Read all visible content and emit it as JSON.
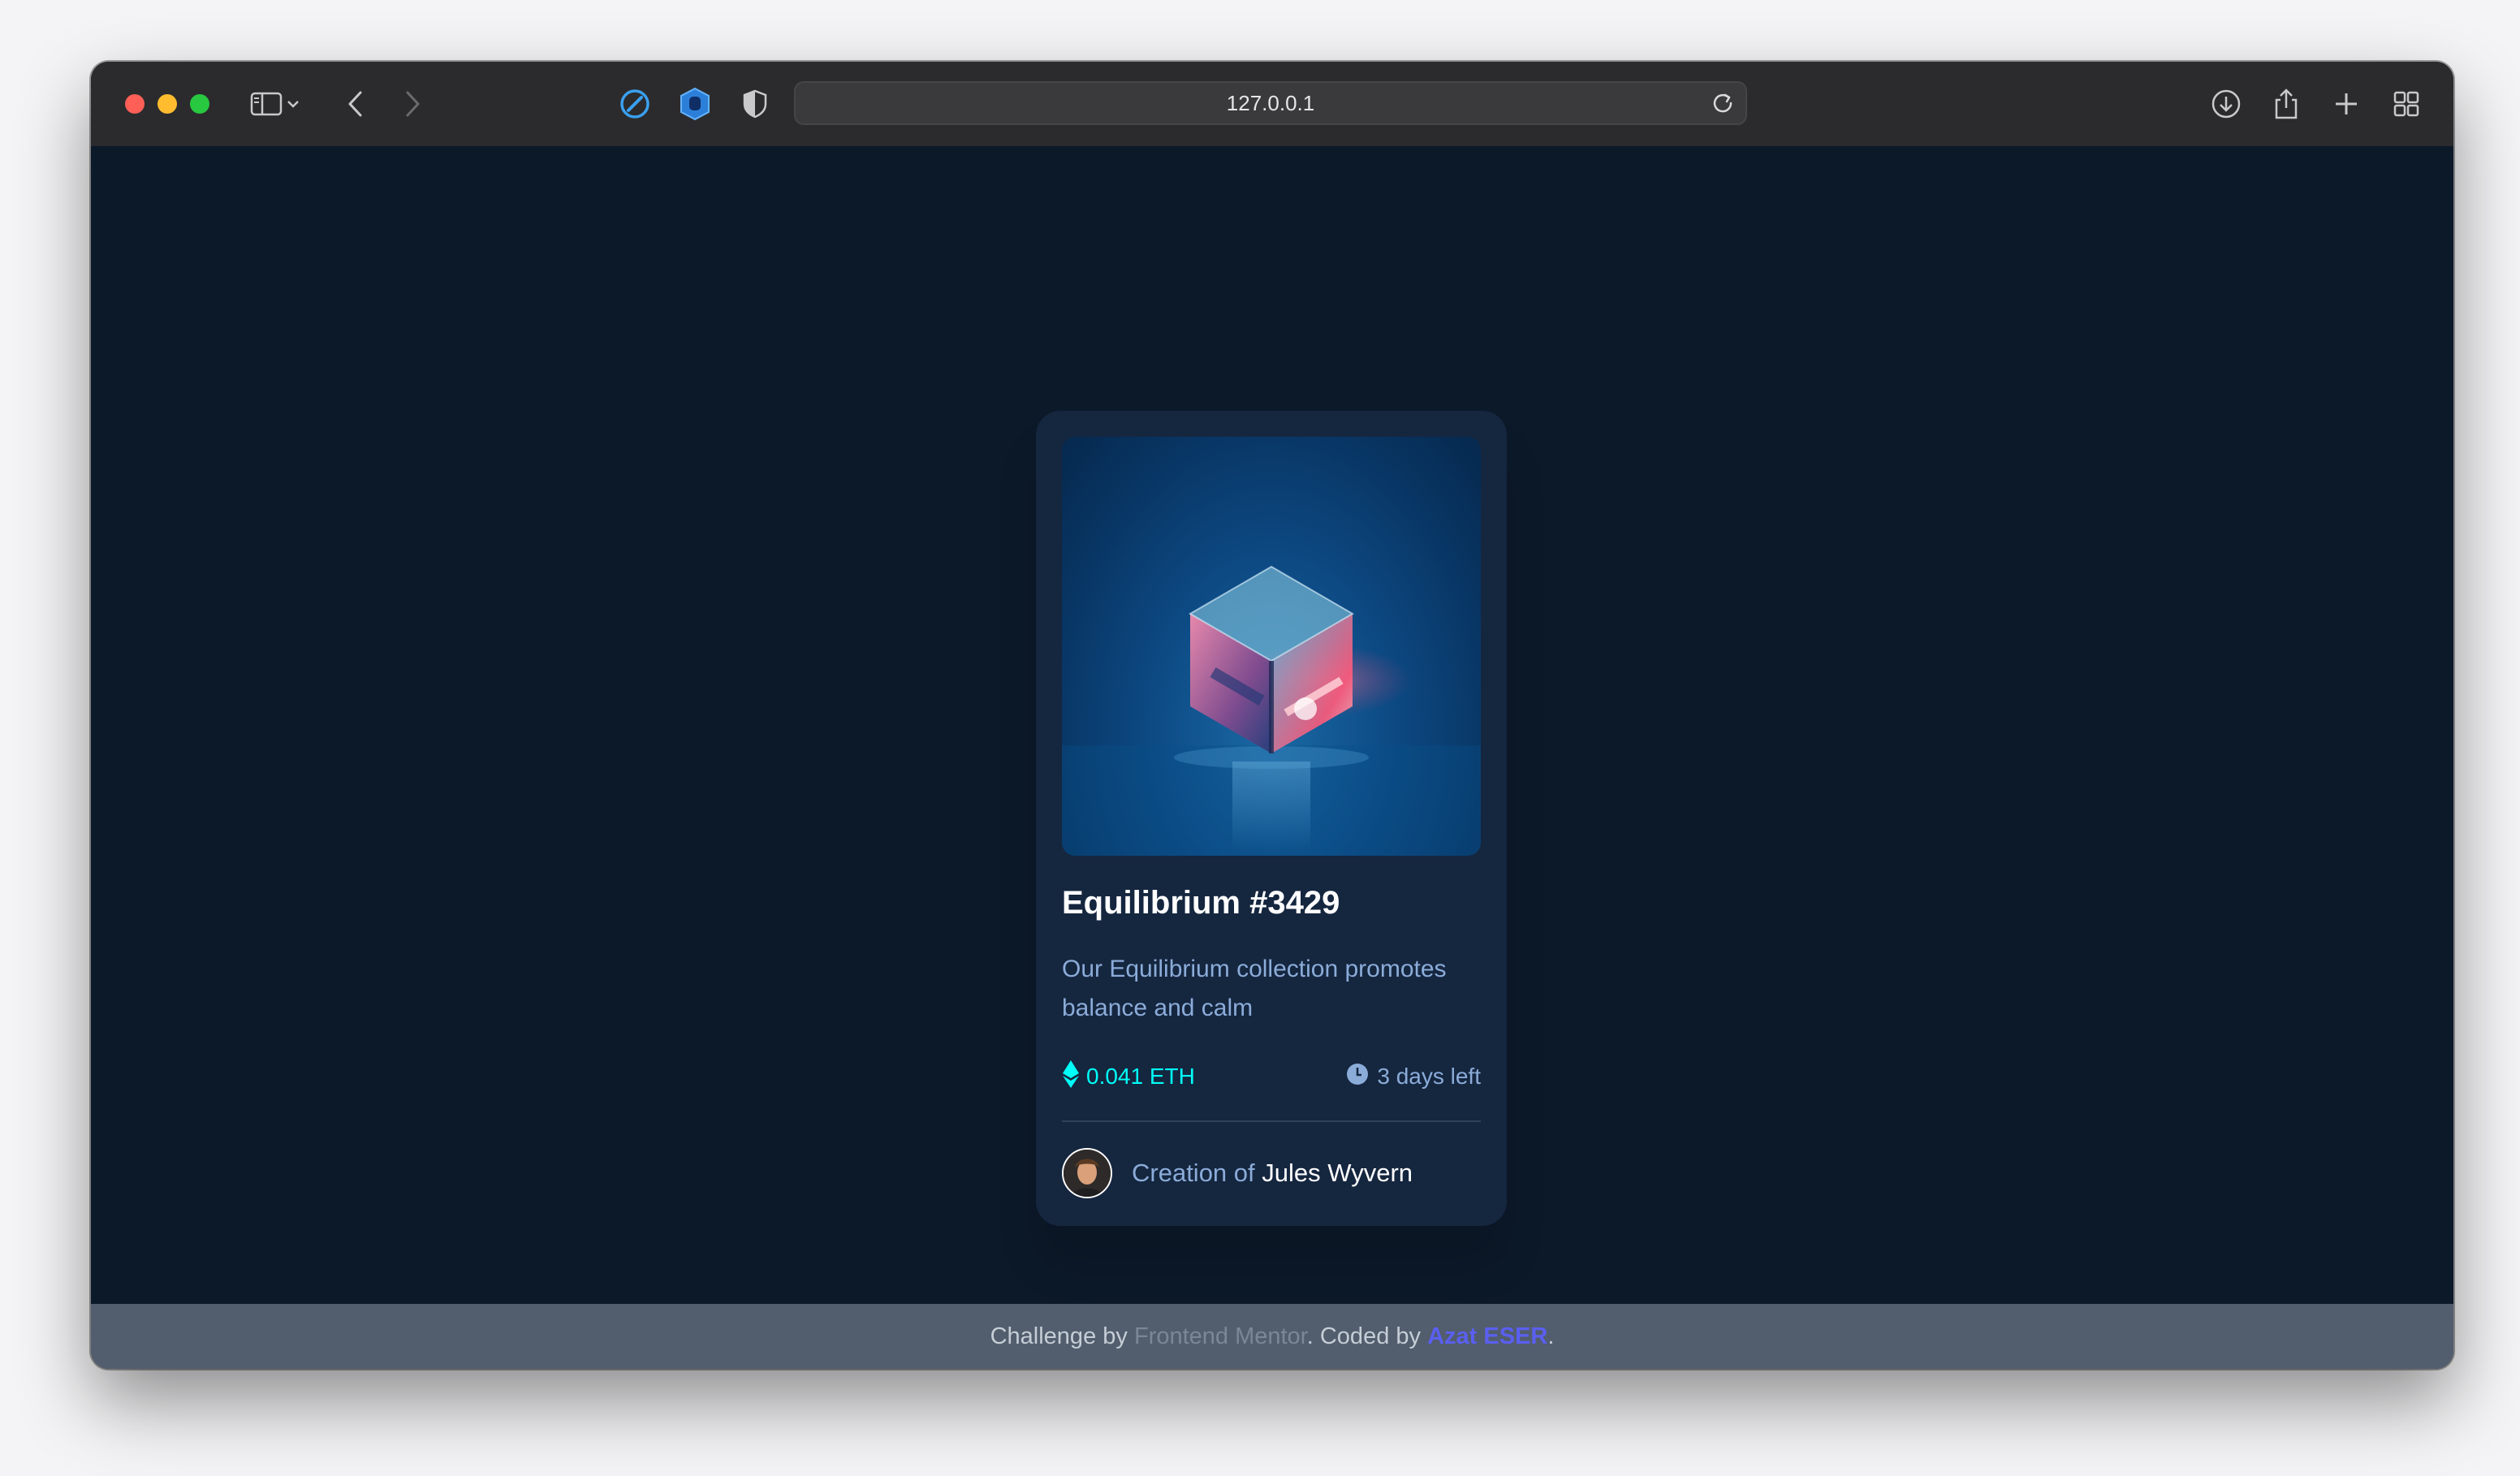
{
  "browser": {
    "url": "127.0.0.1",
    "icons": [
      "sidebar-icon",
      "chevron-down-icon",
      "back-icon",
      "forward-icon",
      "compass-extension-icon",
      "hand-extension-icon",
      "shield-icon",
      "reload-icon",
      "download-icon",
      "share-icon",
      "new-tab-icon",
      "tab-overview-icon"
    ]
  },
  "card": {
    "title": "Equilibrium #3429",
    "description": "Our Equilibrium collection promotes balance and calm",
    "price": "0.041 ETH",
    "time_left": "3 days left",
    "creator_prefix": "Creation of",
    "creator_name": "Jules Wyvern"
  },
  "footer": {
    "prefix": "Challenge by",
    "link_fm": "Frontend Mentor",
    "middle": ". Coded by",
    "link_author": "Azat ESER",
    "suffix": "."
  },
  "colors": {
    "page_bg": "#0c1929",
    "card_bg": "#15263f",
    "cyan": "#00fff8",
    "soft_blue": "#8bacd9",
    "footer_bg": "#525d6d",
    "author_link": "#5a5ff0"
  }
}
